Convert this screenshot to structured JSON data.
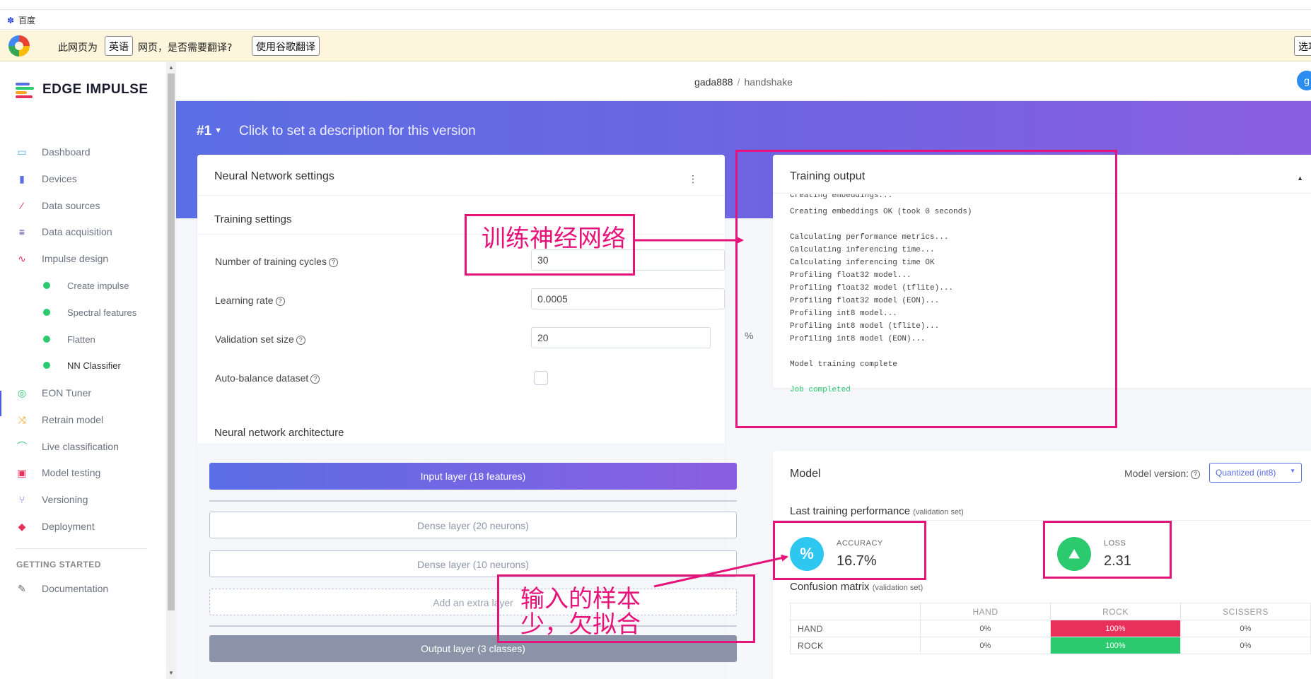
{
  "bookmarks": {
    "baidu_label": "百度"
  },
  "translate_bar": {
    "prefix": "此网页为",
    "language": "英语",
    "suffix": "网页，是否需要翻译?",
    "translate_button": "使用谷歌翻译",
    "options_button": "选项"
  },
  "brand": {
    "name": "EDGE IMPULSE"
  },
  "sidebar": {
    "items": [
      {
        "label": "Dashboard",
        "icon": "monitor-icon"
      },
      {
        "label": "Devices",
        "icon": "chip-icon"
      },
      {
        "label": "Data sources",
        "icon": "wand-icon"
      },
      {
        "label": "Data acquisition",
        "icon": "database-icon"
      },
      {
        "label": "Impulse design",
        "icon": "pulse-icon"
      }
    ],
    "subitems": [
      {
        "label": "Create impulse"
      },
      {
        "label": "Spectral features"
      },
      {
        "label": "Flatten"
      },
      {
        "label": "NN Classifier"
      }
    ],
    "items2": [
      {
        "label": "EON Tuner",
        "icon": "tuner-icon"
      },
      {
        "label": "Retrain model",
        "icon": "shuffle-icon"
      },
      {
        "label": "Live classification",
        "icon": "live-icon"
      },
      {
        "label": "Model testing",
        "icon": "clipboard-icon"
      },
      {
        "label": "Versioning",
        "icon": "branch-icon"
      },
      {
        "label": "Deployment",
        "icon": "package-icon"
      }
    ],
    "section_title": "GETTING STARTED",
    "documentation": "Documentation"
  },
  "breadcrumb": {
    "user": "gada888",
    "separator": "/",
    "project": "handshake"
  },
  "hero": {
    "version": "#1",
    "description": "Click to set a description for this version"
  },
  "settings": {
    "title": "Neural Network settings",
    "training_settings": "Training settings",
    "fields": {
      "cycles_label": "Number of training cycles",
      "cycles_value": "30",
      "lr_label": "Learning rate",
      "lr_value": "0.0005",
      "val_label": "Validation set size",
      "val_value": "20",
      "val_unit": "%",
      "balance_label": "Auto-balance dataset",
      "balance_checked": false
    },
    "arch_title": "Neural network architecture",
    "layers": {
      "input": "Input layer (18 features)",
      "dense1": "Dense layer (20 neurons)",
      "dense2": "Dense layer (10 neurons)",
      "extra": "Add an extra layer",
      "output": "Output layer (3 classes)"
    }
  },
  "training_output": {
    "title": "Training output",
    "log": [
      "Creating embeddings...",
      "Creating embeddings OK (took 0 seconds)",
      "",
      "Calculating performance metrics...",
      "Calculating inferencing time...",
      "Calculating inferencing time OK",
      "Profiling float32 model...",
      "Profiling float32 model (tflite)...",
      "Profiling float32 model (EON)...",
      "Profiling int8 model...",
      "Profiling int8 model (tflite)...",
      "Profiling int8 model (EON)...",
      "",
      "Model training complete",
      ""
    ],
    "job_status": "Job completed"
  },
  "model": {
    "title": "Model",
    "version_label": "Model version:",
    "version_value": "Quantized (int8)",
    "perf_title": "Last training performance",
    "perf_note": "(validation set)",
    "accuracy_label": "ACCURACY",
    "accuracy_value": "16.7%",
    "loss_label": "LOSS",
    "loss_value": "2.31",
    "matrix_title": "Confusion matrix",
    "matrix_note": "(validation set)",
    "matrix_columns": [
      "HAND",
      "ROCK",
      "SCISSERS"
    ],
    "matrix_rows": [
      {
        "label": "HAND",
        "cells": [
          "0%",
          "100%",
          "0%"
        ]
      },
      {
        "label": "ROCK",
        "cells": [
          "0%",
          "100%",
          "0%"
        ]
      }
    ]
  },
  "annotations": {
    "train_nn": "训练神经网络",
    "underfit_line1": "输入的样本",
    "underfit_line2": "少，欠拟合"
  },
  "colors": {
    "accent": "#5b6ee5",
    "annotation": "#e5147a",
    "success": "#2bca6f",
    "error": "#e8305a"
  }
}
